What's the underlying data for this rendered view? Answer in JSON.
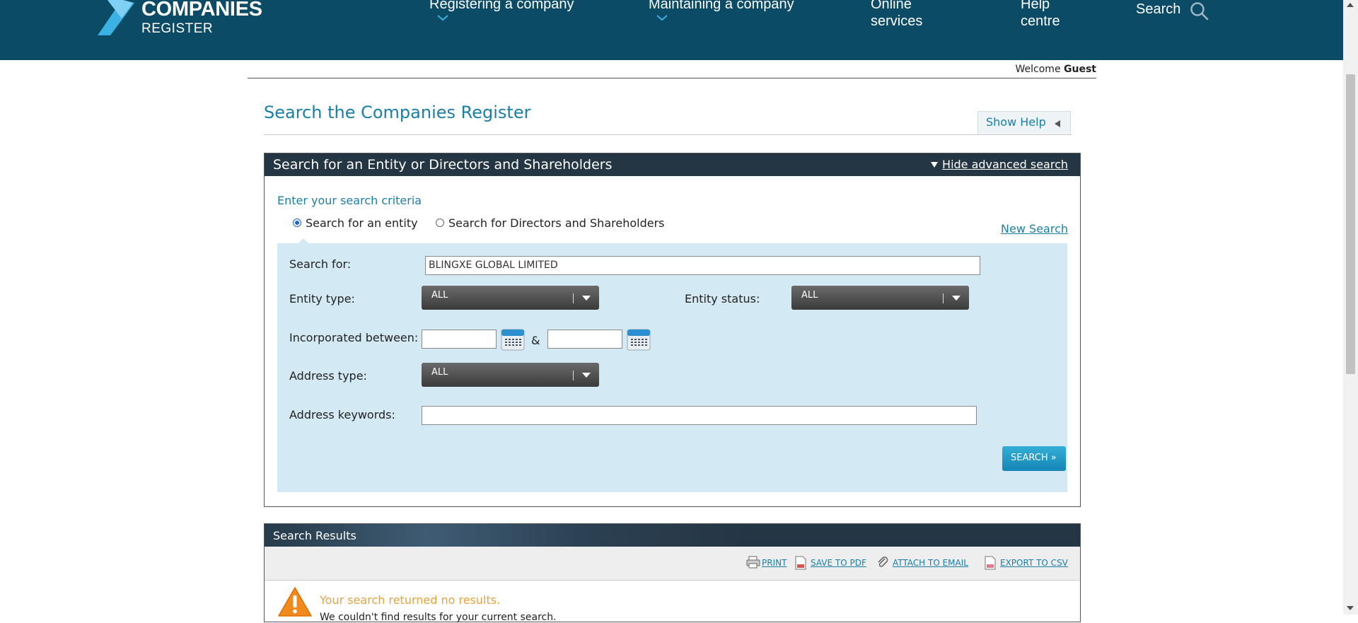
{
  "header": {
    "logo_title": "COMPANIES",
    "logo_sub": "REGISTER",
    "nav": [
      {
        "label": "Registering a company"
      },
      {
        "label": "Maintaining a company"
      },
      {
        "label_line1": "Online",
        "label_line2": "services"
      },
      {
        "label_line1": "Help",
        "label_line2": "centre"
      }
    ],
    "search_label": "Search"
  },
  "welcome": {
    "prefix": "Welcome",
    "user": "Guest"
  },
  "page_title": "Search the Companies Register",
  "show_help": "Show Help",
  "search_panel": {
    "title": "Search for an Entity or Directors and Shareholders",
    "hide_advanced": "Hide advanced search",
    "criteria_label": "Enter your search criteria",
    "radio_entity": "Search for an entity",
    "radio_directors": "Search for Directors and Shareholders",
    "new_search": "New Search",
    "search_for_label": "Search for:",
    "search_for_value": "BLINGXE GLOBAL LIMITED",
    "entity_type_label": "Entity type:",
    "entity_type_value": "ALL",
    "entity_status_label": "Entity status:",
    "entity_status_value": "ALL",
    "incorporated_label": "Incorporated between:",
    "incorporated_from": "",
    "incorporated_to": "",
    "amp": "&",
    "address_type_label": "Address type:",
    "address_type_value": "ALL",
    "address_keywords_label": "Address keywords:",
    "address_keywords_value": "",
    "search_button": "SEARCH »"
  },
  "results": {
    "title": "Search Results",
    "tools": {
      "print": "PRINT",
      "pdf": "SAVE TO PDF",
      "email": "ATTACH TO EMAIL",
      "csv": "EXPORT TO CSV"
    },
    "no_results": "Your search returned no results.",
    "no_results_sub": "We couldn't find results for your current search."
  },
  "colors": {
    "header_bg": "#0b4b66",
    "accent": "#1a7fa8",
    "panel_head": "#243544",
    "form_bg": "#d3e9f3",
    "warning": "#e6a23c"
  }
}
